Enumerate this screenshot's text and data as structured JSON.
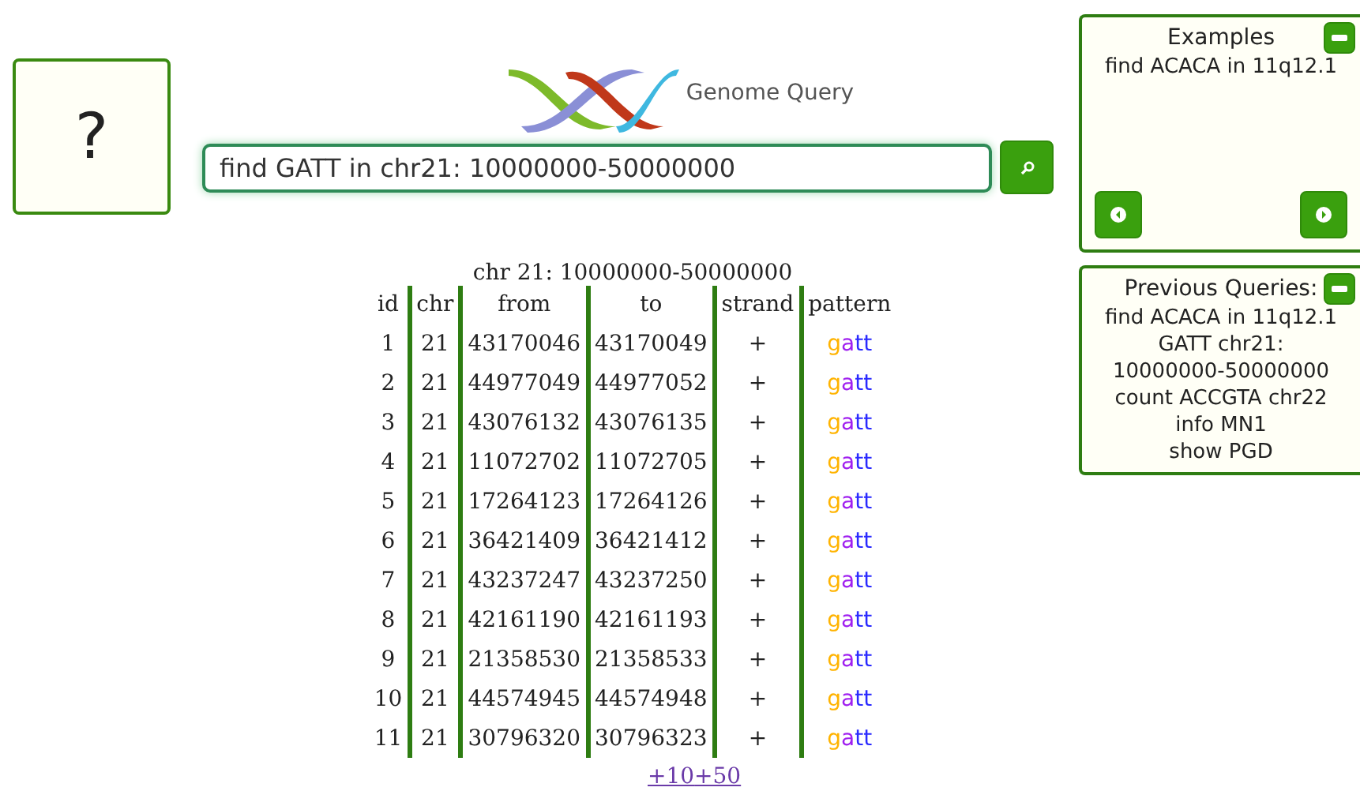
{
  "help_box": {
    "label": "?"
  },
  "logo": {
    "title": "Genome Query"
  },
  "search": {
    "value": "find GATT in chr21: 10000000-50000000"
  },
  "results": {
    "caption": "chr 21: 10000000-50000000",
    "columns": [
      "id",
      "chr",
      "from",
      "to",
      "strand",
      "pattern"
    ],
    "rows": [
      {
        "id": "1",
        "chr": "21",
        "from": "43170046",
        "to": "43170049",
        "strand": "+",
        "pattern": [
          {
            "letter": "g",
            "color": "#ffb300"
          },
          {
            "letter": "a",
            "color": "#a020f0"
          },
          {
            "letter": "tt",
            "color": "#2a2aff"
          }
        ]
      },
      {
        "id": "2",
        "chr": "21",
        "from": "44977049",
        "to": "44977052",
        "strand": "+",
        "pattern": [
          {
            "letter": "g",
            "color": "#ffb300"
          },
          {
            "letter": "a",
            "color": "#a020f0"
          },
          {
            "letter": "tt",
            "color": "#2a2aff"
          }
        ]
      },
      {
        "id": "3",
        "chr": "21",
        "from": "43076132",
        "to": "43076135",
        "strand": "+",
        "pattern": [
          {
            "letter": "g",
            "color": "#ffb300"
          },
          {
            "letter": "a",
            "color": "#a020f0"
          },
          {
            "letter": "tt",
            "color": "#2a2aff"
          }
        ]
      },
      {
        "id": "4",
        "chr": "21",
        "from": "11072702",
        "to": "11072705",
        "strand": "+",
        "pattern": [
          {
            "letter": "g",
            "color": "#ffb300"
          },
          {
            "letter": "a",
            "color": "#a020f0"
          },
          {
            "letter": "tt",
            "color": "#2a2aff"
          }
        ]
      },
      {
        "id": "5",
        "chr": "21",
        "from": "17264123",
        "to": "17264126",
        "strand": "+",
        "pattern": [
          {
            "letter": "g",
            "color": "#ffb300"
          },
          {
            "letter": "a",
            "color": "#a020f0"
          },
          {
            "letter": "tt",
            "color": "#2a2aff"
          }
        ]
      },
      {
        "id": "6",
        "chr": "21",
        "from": "36421409",
        "to": "36421412",
        "strand": "+",
        "pattern": [
          {
            "letter": "g",
            "color": "#ffb300"
          },
          {
            "letter": "a",
            "color": "#a020f0"
          },
          {
            "letter": "tt",
            "color": "#2a2aff"
          }
        ]
      },
      {
        "id": "7",
        "chr": "21",
        "from": "43237247",
        "to": "43237250",
        "strand": "+",
        "pattern": [
          {
            "letter": "g",
            "color": "#ffb300"
          },
          {
            "letter": "a",
            "color": "#a020f0"
          },
          {
            "letter": "tt",
            "color": "#2a2aff"
          }
        ]
      },
      {
        "id": "8",
        "chr": "21",
        "from": "42161190",
        "to": "42161193",
        "strand": "+",
        "pattern": [
          {
            "letter": "g",
            "color": "#ffb300"
          },
          {
            "letter": "a",
            "color": "#a020f0"
          },
          {
            "letter": "tt",
            "color": "#2a2aff"
          }
        ]
      },
      {
        "id": "9",
        "chr": "21",
        "from": "21358530",
        "to": "21358533",
        "strand": "+",
        "pattern": [
          {
            "letter": "g",
            "color": "#ffb300"
          },
          {
            "letter": "a",
            "color": "#a020f0"
          },
          {
            "letter": "tt",
            "color": "#2a2aff"
          }
        ]
      },
      {
        "id": "10",
        "chr": "21",
        "from": "44574945",
        "to": "44574948",
        "strand": "+",
        "pattern": [
          {
            "letter": "g",
            "color": "#ffb300"
          },
          {
            "letter": "a",
            "color": "#a020f0"
          },
          {
            "letter": "tt",
            "color": "#2a2aff"
          }
        ]
      },
      {
        "id": "11",
        "chr": "21",
        "from": "30796320",
        "to": "30796323",
        "strand": "+",
        "pattern": [
          {
            "letter": "g",
            "color": "#ffb300"
          },
          {
            "letter": "a",
            "color": "#a020f0"
          },
          {
            "letter": "tt",
            "color": "#2a2aff"
          }
        ]
      }
    ],
    "more_links": [
      "+10",
      "+50"
    ]
  },
  "examples": {
    "title": "Examples",
    "items": [
      "find ACACA in 11q12.1"
    ]
  },
  "previous_queries": {
    "title": "Previous Queries:",
    "items": [
      "find ACACA in 11q12.1",
      "GATT chr21: 10000000-50000000",
      "count ACCGTA chr22",
      "info MN1",
      "show PGD"
    ]
  }
}
